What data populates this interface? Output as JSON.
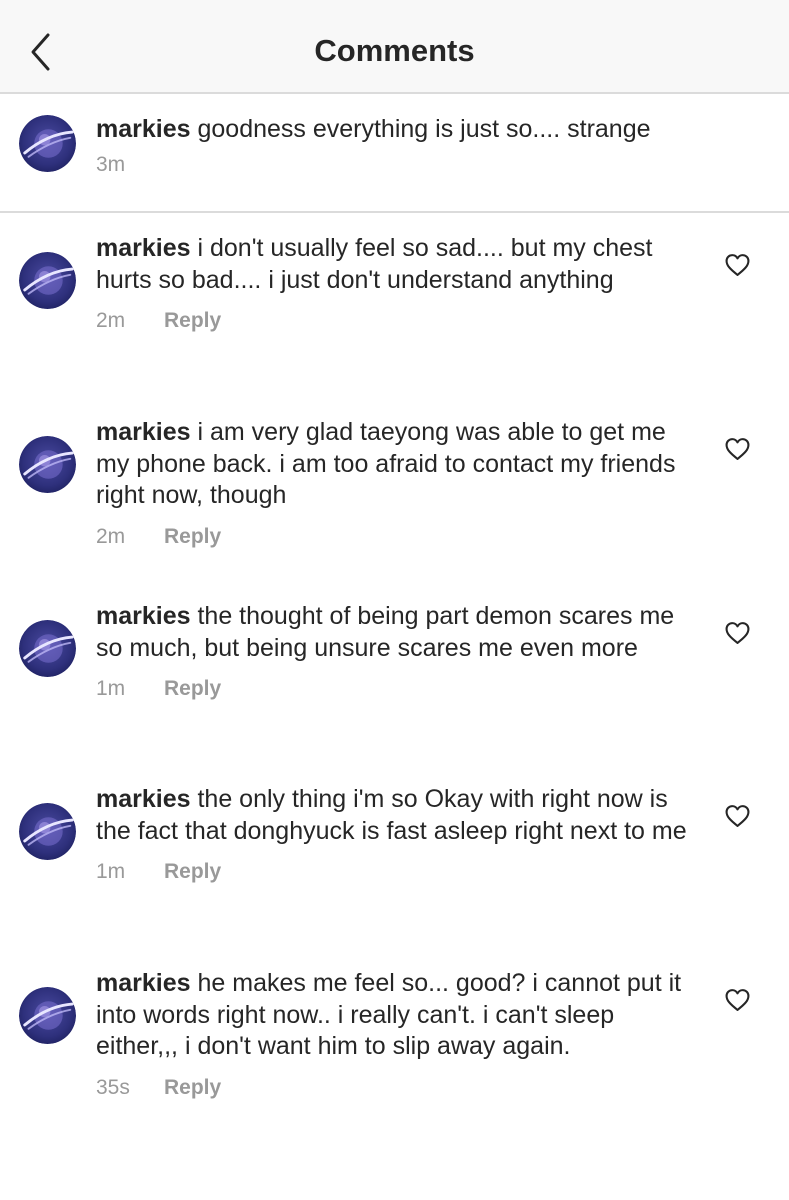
{
  "header": {
    "title": "Comments"
  },
  "caption": {
    "username": "markies",
    "text": "goodness everything is just so.... strange",
    "time": "3m"
  },
  "comments": [
    {
      "username": "markies",
      "text": "i don't usually feel so sad.... but my chest hurts so bad.... i just don't understand anything",
      "time": "2m",
      "reply_label": "Reply"
    },
    {
      "username": "markies",
      "text": "i am very glad taeyong was able to get me my phone back. i am too afraid to contact my friends right now, though",
      "time": "2m",
      "reply_label": "Reply"
    },
    {
      "username": "markies",
      "text": "the thought of being part demon scares me so much, but being unsure scares me even more",
      "time": "1m",
      "reply_label": "Reply"
    },
    {
      "username": "markies",
      "text": "the only thing i'm so Okay with right now is the fact that donghyuck is fast asleep right next to me",
      "time": "1m",
      "reply_label": "Reply"
    },
    {
      "username": "markies",
      "text": "he makes me feel so... good? i cannot put it into words right now.. i really can't. i can't sleep either,,, i don't want him to slip away again.",
      "time": "35s",
      "reply_label": "Reply"
    }
  ],
  "icons": {
    "back": "chevron-left-icon",
    "like": "heart-outline-icon",
    "avatar": "planet-avatar"
  },
  "colors": {
    "text": "#262626",
    "meta": "#999999",
    "divider": "#dbdbdb",
    "header_bg": "#f8f8f8",
    "avatar_bg": "#2d2f7a"
  }
}
